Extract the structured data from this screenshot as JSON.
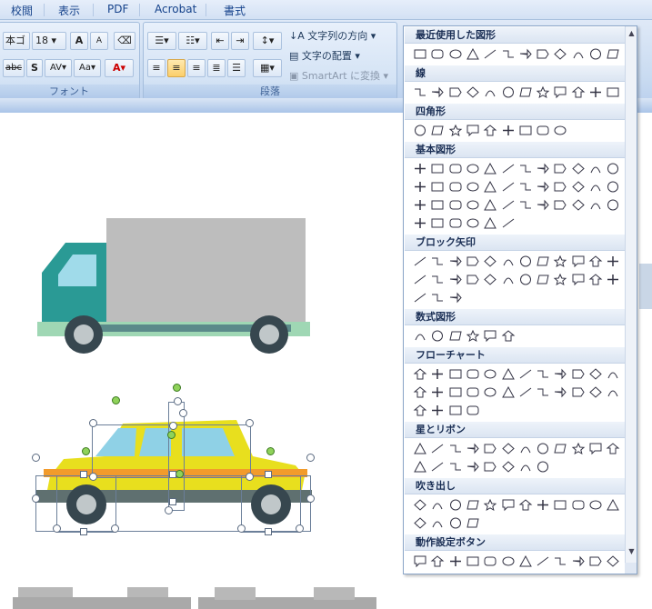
{
  "tabs": [
    "校閲",
    "表示",
    "PDF",
    "Acrobat",
    "書式"
  ],
  "font_group": {
    "font_name": "本ゴ",
    "font_size": "18",
    "label": "フォント"
  },
  "paragraph_group": {
    "label": "段落"
  },
  "text_tools": {
    "direction": "文字列の方向",
    "align": "文字の配置",
    "smartart": "SmartArt に変換"
  },
  "gallery": {
    "sections": [
      {
        "title": "最近使用した図形",
        "rows": [
          12
        ]
      },
      {
        "title": "線",
        "rows": [
          12
        ]
      },
      {
        "title": "四角形",
        "rows": [
          9
        ]
      },
      {
        "title": "基本図形",
        "rows": [
          12,
          12,
          12,
          6
        ]
      },
      {
        "title": "ブロック矢印",
        "rows": [
          12,
          12,
          3
        ]
      },
      {
        "title": "数式図形",
        "rows": [
          6
        ]
      },
      {
        "title": "フローチャート",
        "rows": [
          12,
          12,
          4
        ]
      },
      {
        "title": "星とリボン",
        "rows": [
          12,
          8
        ]
      },
      {
        "title": "吹き出し",
        "rows": [
          12,
          4
        ]
      },
      {
        "title": "動作設定ボタン",
        "rows": [
          12
        ]
      }
    ]
  },
  "colors": {
    "truck_cab": "#2a9a95",
    "truck_box": "#bdbdbd",
    "taxi_body": "#e8df1e",
    "taxi_window": "#8fd1e6",
    "ribbon_blue": "#c9dbf1"
  }
}
